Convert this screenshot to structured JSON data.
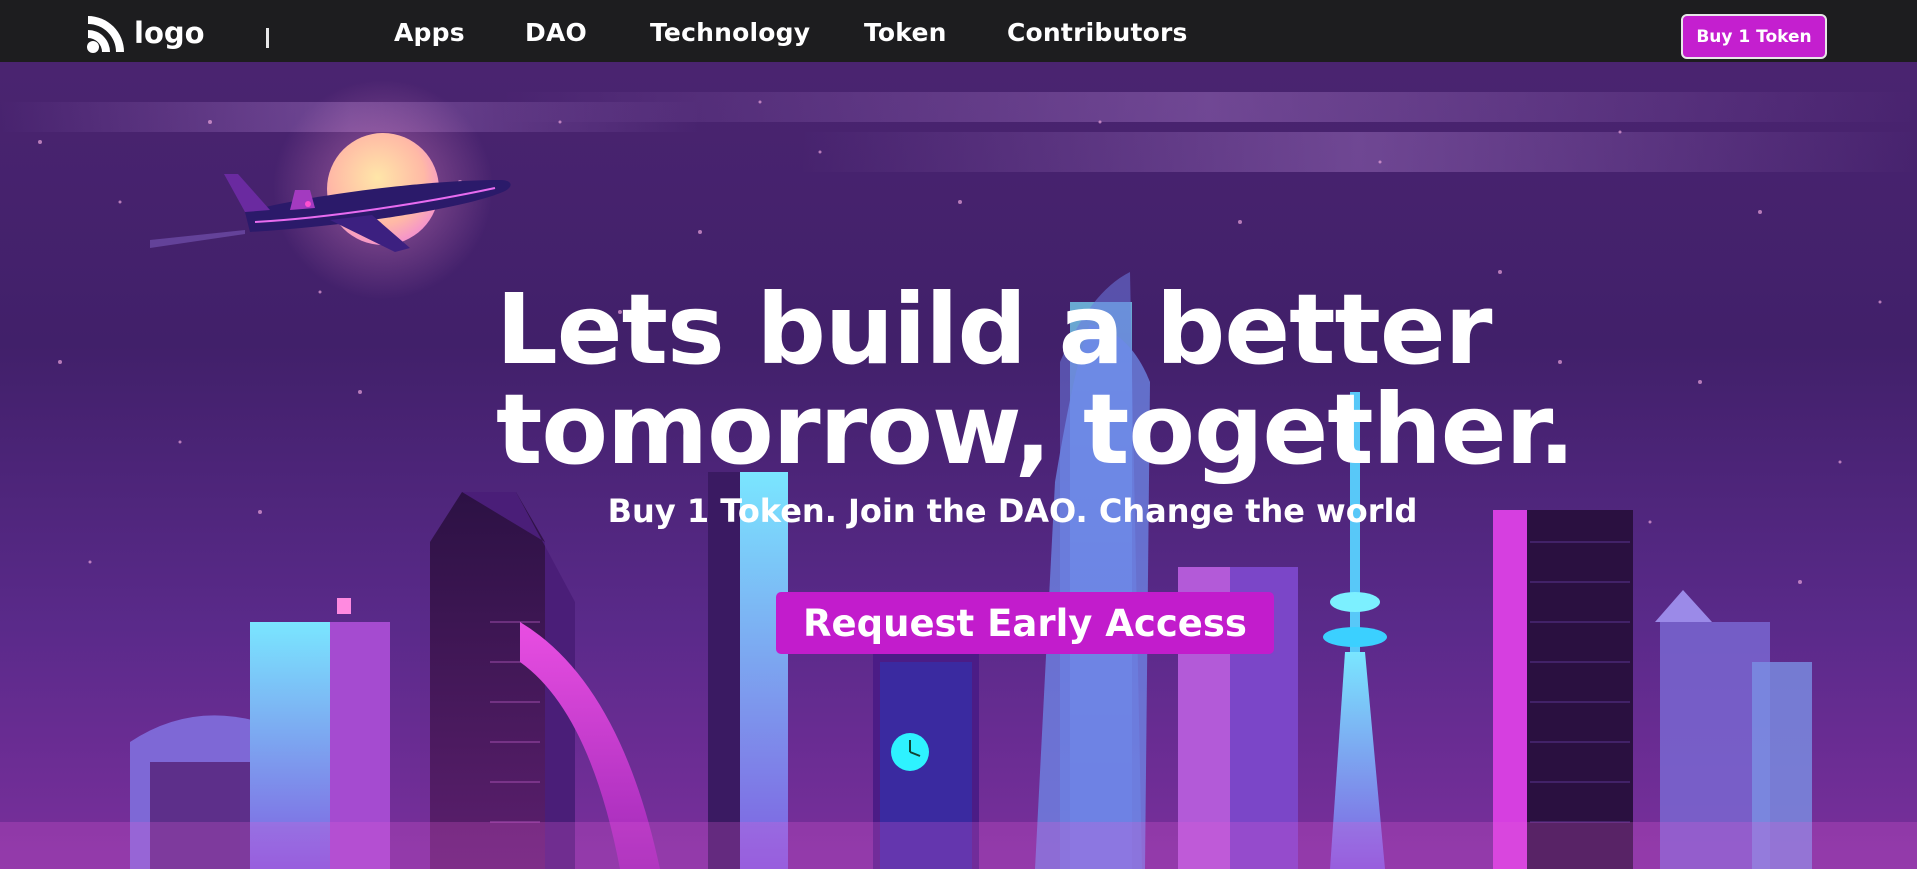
{
  "nav": {
    "logo_text": "logo",
    "links": [
      "Apps",
      "DAO",
      "Technology",
      "Token",
      "Contributors"
    ],
    "buy_button": "Buy 1 Token"
  },
  "hero": {
    "headline_line1": "Lets build a better",
    "headline_line2": "tomorrow, together.",
    "subheadline": "Buy 1 Token. Join the DAO. Change the world",
    "cta_button": "Request Early Access"
  },
  "colors": {
    "nav_background": "#1d1d1f",
    "accent": "#c21ccc",
    "sky": "#3b1a5e"
  },
  "icons": {
    "logo": "rss-feed-icon"
  }
}
